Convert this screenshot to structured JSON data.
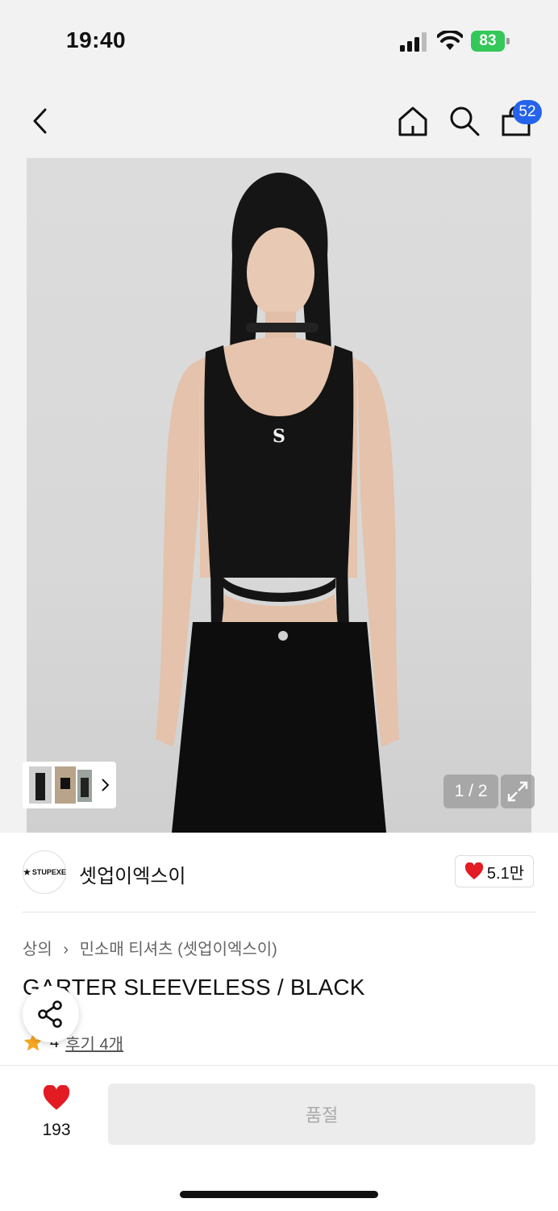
{
  "status": {
    "time": "19:40",
    "battery": "83"
  },
  "nav": {
    "back_icon": "chevron-left-icon",
    "home_icon": "home-icon",
    "search_icon": "search-icon",
    "bag_icon": "shopping-bag-icon",
    "bag_count": "52"
  },
  "gallery": {
    "pager": "1 / 2"
  },
  "brand": {
    "logo_text": "STUPEXE",
    "name": "셋업이엑스이",
    "likes": "5.1만"
  },
  "breadcrumb": {
    "category": "상의",
    "separator": "›",
    "subcategory": "민소매 티셔츠 (셋업이엑스이)"
  },
  "product": {
    "title": "GARTER SLEEVELESS / BLACK",
    "rating": "4",
    "reviews": "후기 4개"
  },
  "bottom": {
    "wish_count": "193",
    "buy_label": "품절"
  },
  "colors": {
    "accent_blue": "#2563eb",
    "heart_red": "#e31b23",
    "star": "#f5a623",
    "battery_green": "#34c759"
  }
}
